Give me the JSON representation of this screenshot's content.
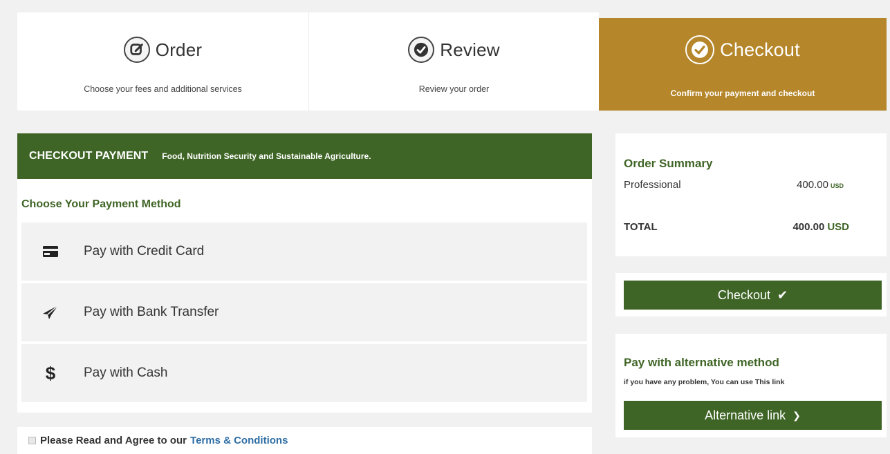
{
  "steps": [
    {
      "title": "Order",
      "subtitle": "Choose your fees and additional services",
      "icon": "edit-icon",
      "active": false
    },
    {
      "title": "Review",
      "subtitle": "Review your order",
      "icon": "check-circle-icon",
      "active": false
    },
    {
      "title": "Checkout",
      "subtitle": "Confirm your payment and checkout",
      "icon": "check-circle-icon",
      "active": true
    }
  ],
  "payment": {
    "header_title": "CHECKOUT PAYMENT",
    "header_subtitle": "Food, Nutrition Security and Sustainable Agriculture.",
    "choose_label": "Choose Your Payment Method",
    "methods": [
      {
        "label": "Pay with Credit Card",
        "icon": "credit-card-icon"
      },
      {
        "label": "Pay with Bank Transfer",
        "icon": "paper-plane-icon"
      },
      {
        "label": "Pay with Cash",
        "icon": "dollar-icon",
        "glyph": "$"
      }
    ]
  },
  "terms": {
    "text": "Please Read and Agree to our",
    "link": "Terms & Conditions"
  },
  "summary": {
    "title": "Order Summary",
    "item_name": "Professional",
    "item_amount": "400.00",
    "item_currency": "USD",
    "total_label": "TOTAL",
    "total_amount": "400.00",
    "total_currency": "USD"
  },
  "checkout": {
    "label": "Checkout",
    "glyph": "✔"
  },
  "alternative": {
    "title": "Pay with alternative method",
    "subtitle": "if you have any problem, You can use This link",
    "button_label": "Alternative link",
    "glyph": "❯"
  },
  "colors": {
    "primary_green": "#3f6526",
    "active_step": "#b5862a",
    "link_blue": "#2e6da4"
  }
}
